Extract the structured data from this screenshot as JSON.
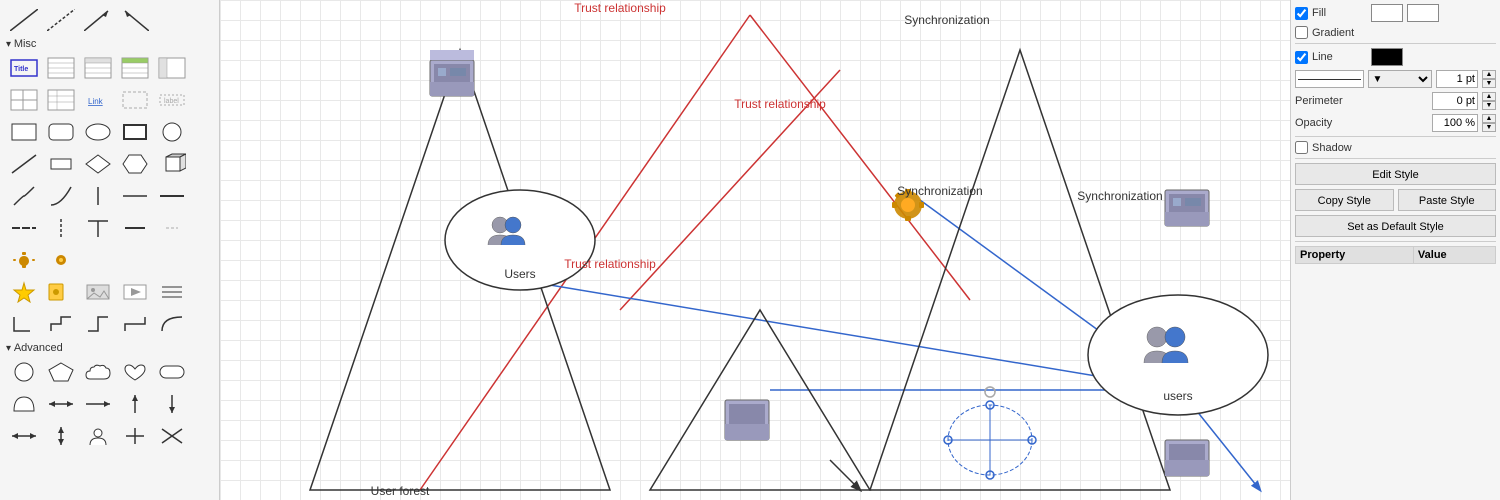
{
  "sidebar": {
    "sections": [
      {
        "name": "Misc",
        "label": "Misc"
      },
      {
        "name": "Advanced",
        "label": "Advanced"
      }
    ]
  },
  "right_panel": {
    "fill_label": "Fill",
    "gradient_label": "Gradient",
    "line_label": "Line",
    "perimeter_label": "Perimeter",
    "opacity_label": "Opacity",
    "shadow_label": "Shadow",
    "fill_checked": true,
    "gradient_checked": false,
    "line_checked": true,
    "shadow_checked": false,
    "line_width": "1 pt",
    "perimeter_value": "0 pt",
    "opacity_value": "100 %",
    "edit_style_label": "Edit Style",
    "copy_style_label": "Copy Style",
    "paste_style_label": "Paste Style",
    "set_default_label": "Set as Default Style",
    "property_col": "Property",
    "value_col": "Value"
  },
  "diagram": {
    "labels": {
      "trust_relationship_1": "Trust relationship",
      "trust_relationship_2": "Trust relationship",
      "trust_relationship_3": "Trust relationship",
      "synchronization_1": "Synchronization",
      "synchronization_2": "Synchronization",
      "synchronization_3": "Synchronization",
      "users_label": "Users",
      "users_lower": "users",
      "user_forest": "User forest"
    }
  }
}
